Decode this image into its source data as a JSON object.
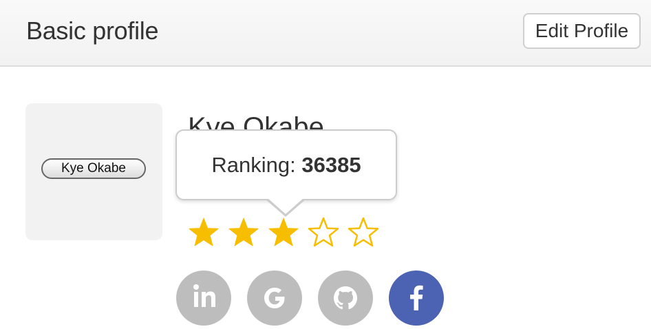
{
  "header": {
    "title": "Basic profile",
    "edit_label": "Edit Profile"
  },
  "profile": {
    "avatar_label": "Kye Okabe",
    "name": "Kye Okabe",
    "ranking_label": "Ranking:",
    "ranking_value": "36385",
    "rating": {
      "value": 3,
      "max": 5,
      "star_color": "#f7be00"
    }
  },
  "social": [
    {
      "name": "linkedin-icon",
      "color": "#bdbdbd"
    },
    {
      "name": "google-icon",
      "color": "#bdbdbd"
    },
    {
      "name": "github-icon",
      "color": "#bdbdbd"
    },
    {
      "name": "facebook-icon",
      "color": "#4c62b2"
    }
  ]
}
